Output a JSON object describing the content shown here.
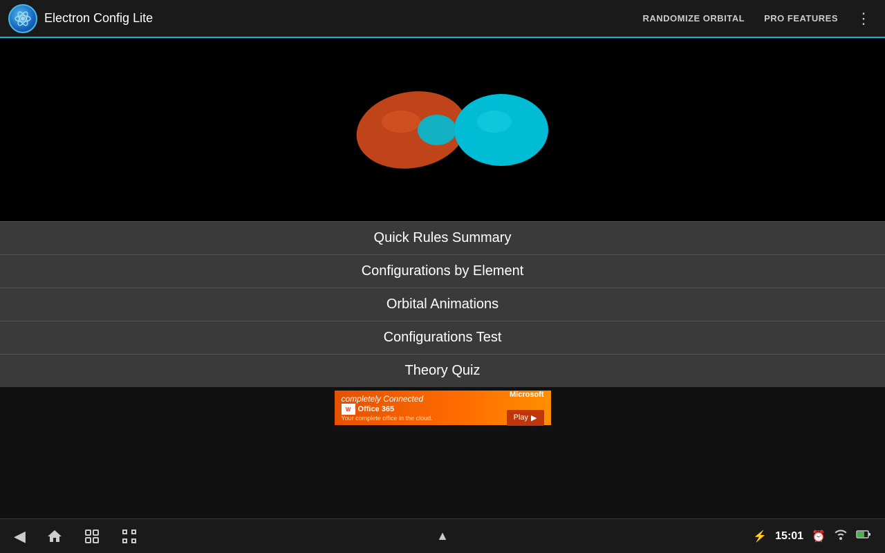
{
  "app": {
    "title": "Electron Config Lite",
    "logo_alt": "atom-icon"
  },
  "header": {
    "randomize_label": "RANDOMIZE ORBITAL",
    "pro_features_label": "PRO FEATURES"
  },
  "menu": {
    "buttons": [
      {
        "label": "Quick Rules Summary",
        "id": "quick-rules"
      },
      {
        "label": "Configurations by Element",
        "id": "configurations-element"
      },
      {
        "label": "Orbital Animations",
        "id": "orbital-animations"
      },
      {
        "label": "Configurations Test",
        "id": "configurations-test"
      },
      {
        "label": "Theory Quiz",
        "id": "theory-quiz"
      }
    ]
  },
  "ad": {
    "tagline": "completely Connected",
    "brand": "Microsoft",
    "product": "Office 365",
    "description": "Your complete office in the cloud.",
    "cta": "Play"
  },
  "bottom_bar": {
    "time": "15:01"
  }
}
